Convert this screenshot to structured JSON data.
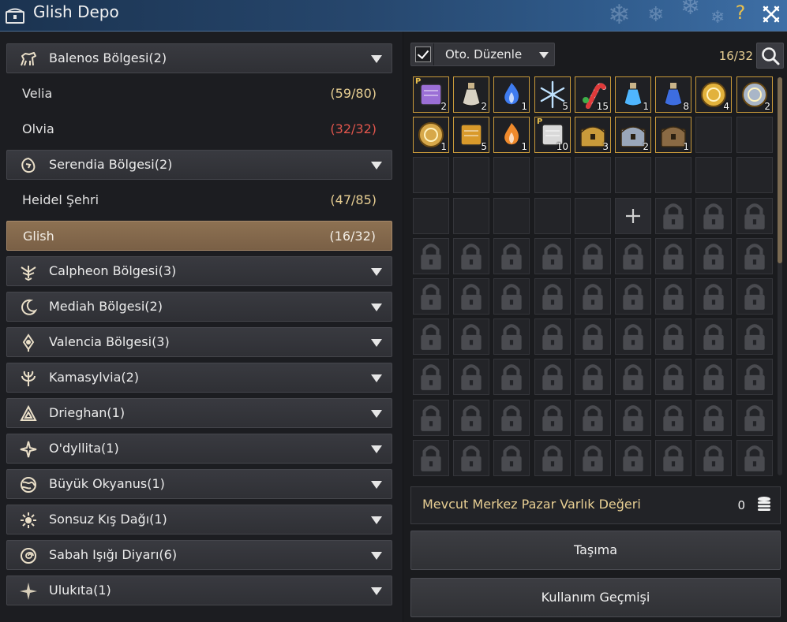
{
  "window": {
    "title": "Glish Depo",
    "help": "?"
  },
  "regions": [
    {
      "label": "Balenos Bölgesi(2)",
      "icon": "horse-icon",
      "towns": [
        {
          "name": "Velia",
          "count": "(59/80)",
          "full": false
        },
        {
          "name": "Olvia",
          "count": "(32/32)",
          "full": true
        }
      ]
    },
    {
      "label": "Serendia Bölgesi(2)",
      "icon": "lion-icon",
      "towns": [
        {
          "name": "Heidel Şehri",
          "count": "(47/85)",
          "full": false
        },
        {
          "name": "Glish",
          "count": "(16/32)",
          "full": false,
          "active": true
        }
      ]
    },
    {
      "label": "Calpheon Bölgesi(3)",
      "icon": "eagle-crest-icon"
    },
    {
      "label": "Mediah Bölgesi(2)",
      "icon": "crescent-moon-icon"
    },
    {
      "label": "Valencia Bölgesi(3)",
      "icon": "sun-diamond-icon"
    },
    {
      "label": "Kamasylvia(2)",
      "icon": "tree-icon"
    },
    {
      "label": "Drieghan(1)",
      "icon": "triangle-knot-icon"
    },
    {
      "label": "O'dyllita(1)",
      "icon": "compass-star-icon"
    },
    {
      "label": "Büyük Okyanus(1)",
      "icon": "globe-icon"
    },
    {
      "label": "Sonsuz Kış Dağı(1)",
      "icon": "snow-sun-icon"
    },
    {
      "label": "Sabah Işığı Diyarı(6)",
      "icon": "spiral-sun-icon"
    },
    {
      "label": "Ulukıta(1)",
      "icon": "four-point-star-icon"
    }
  ],
  "toolbar": {
    "auto_sort_label": "Oto. Düzenle",
    "auto_sort_checked": true,
    "capacity": "16/32"
  },
  "items": [
    {
      "name": "purple-scroll",
      "qty": "2",
      "p": "P",
      "color": "#9b6fd6"
    },
    {
      "name": "white-vase",
      "qty": "2",
      "p": "",
      "color": "#d8d2c4"
    },
    {
      "name": "blue-flame",
      "qty": "1",
      "p": "",
      "color": "#3f7cf0"
    },
    {
      "name": "snowflake",
      "qty": "5",
      "p": "",
      "color": "#bfe2ff"
    },
    {
      "name": "candy-cane",
      "qty": "15",
      "p": "",
      "color": "#e03a3a"
    },
    {
      "name": "blue-potion",
      "qty": "1",
      "p": "",
      "color": "#4fb6ff"
    },
    {
      "name": "elixir-bottle",
      "qty": "8",
      "p": "",
      "color": "#3d6de0"
    },
    {
      "name": "gold-coin",
      "qty": "4",
      "p": "",
      "color": "#e2b23c"
    },
    {
      "name": "silver-crystal-disc",
      "qty": "2",
      "p": "",
      "color": "#a9b6c8"
    },
    {
      "name": "gold-ring-disc",
      "qty": "1",
      "p": "",
      "color": "#d7a84a"
    },
    {
      "name": "gold-map",
      "qty": "5",
      "p": "",
      "color": "#d99a2b"
    },
    {
      "name": "fire-flame",
      "qty": "1",
      "p": "",
      "color": "#f08a2c"
    },
    {
      "name": "white-scroll",
      "qty": "10",
      "p": "P",
      "color": "#d9d9d9"
    },
    {
      "name": "gold-chest",
      "qty": "3",
      "p": "",
      "color": "#c99a3a"
    },
    {
      "name": "silver-chest",
      "qty": "2",
      "p": "",
      "color": "#9aa7ba"
    },
    {
      "name": "wood-chest",
      "qty": "1",
      "p": "",
      "color": "#8a6a44"
    }
  ],
  "market": {
    "label": "Mevcut Merkez Pazar Varlık Değeri",
    "value": "0"
  },
  "buttons": {
    "transport": "Taşıma",
    "history": "Kullanım Geçmişi"
  }
}
